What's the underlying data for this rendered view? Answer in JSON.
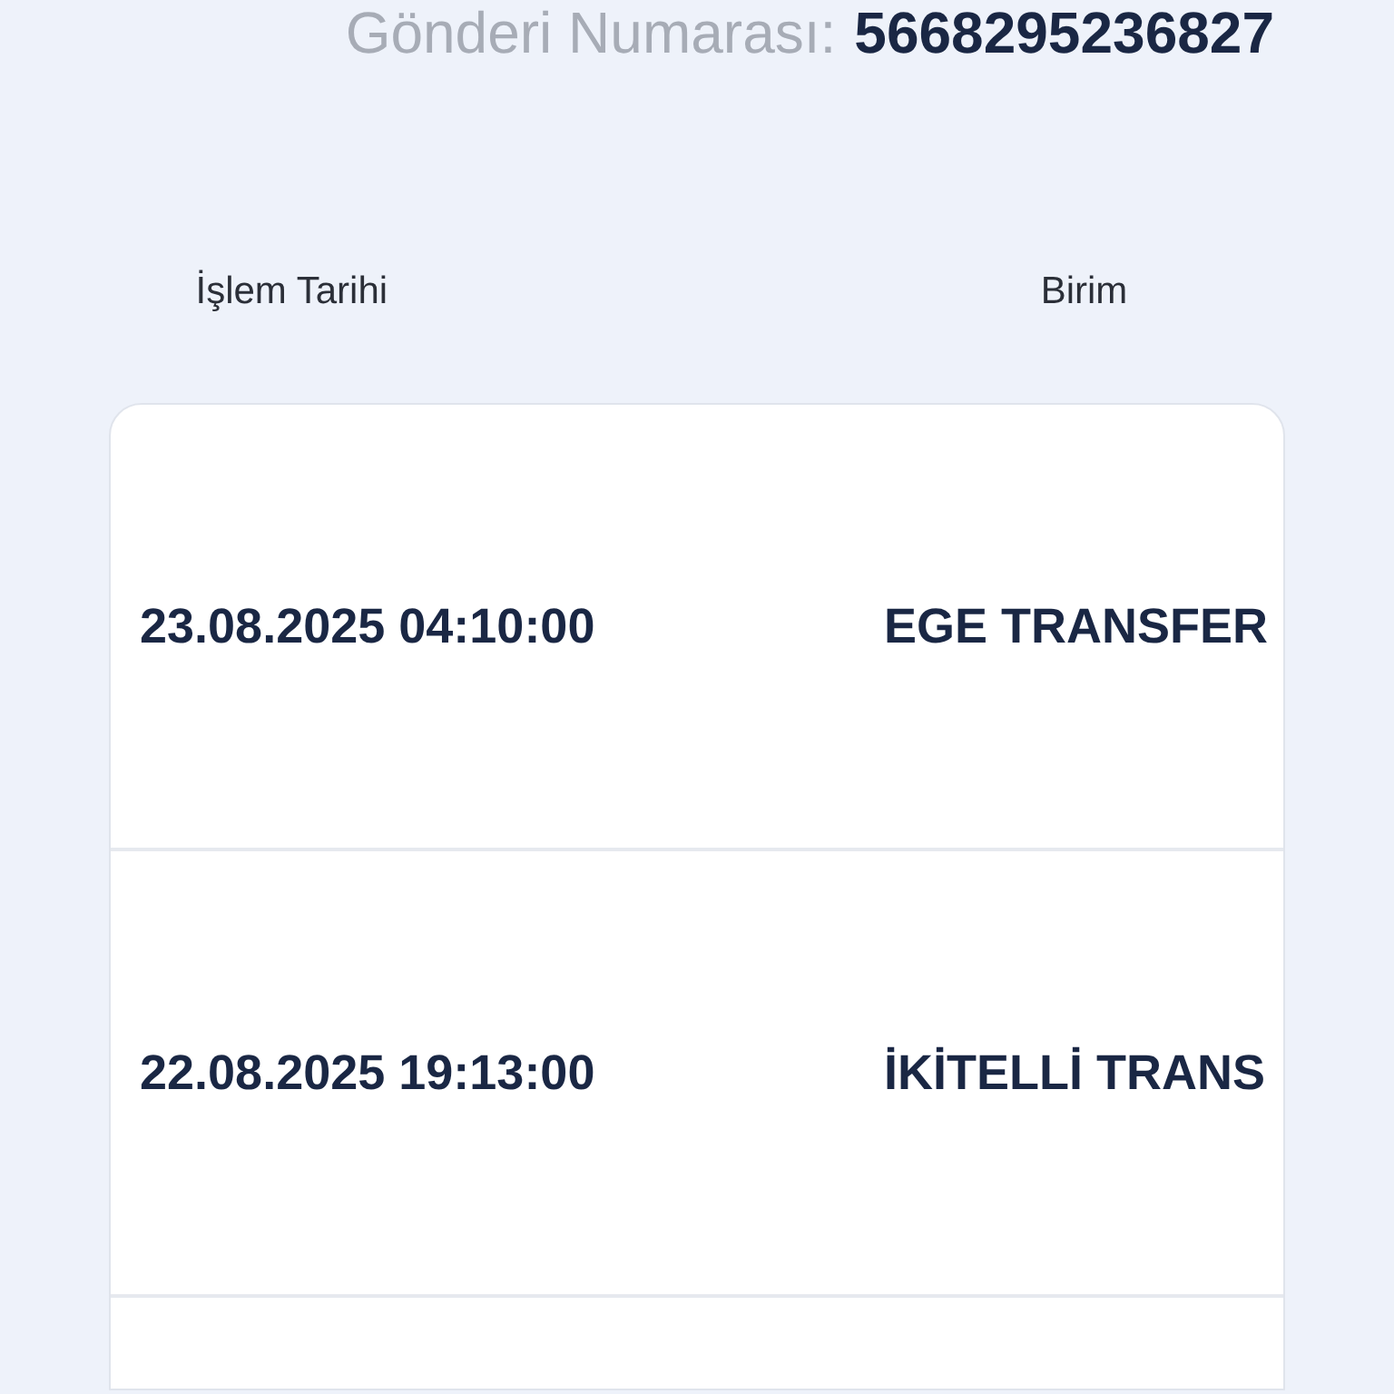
{
  "shipment": {
    "label": "Gönderi Numarası:",
    "number": "5668295236827"
  },
  "table": {
    "columns": [
      "İşlem Tarihi",
      "Birim"
    ],
    "rows": [
      {
        "date": "23.08.2025 04:10:00",
        "unit": "EGE TRANSFER"
      },
      {
        "date": "22.08.2025 19:13:00",
        "unit": "İKİTELLİ TRANS"
      }
    ]
  }
}
